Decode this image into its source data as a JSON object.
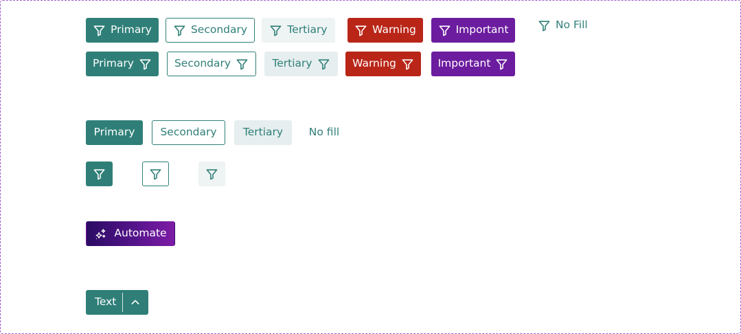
{
  "row1": {
    "primary": "Primary",
    "secondary": "Secondary",
    "tertiary": "Tertiary",
    "warning": "Warning",
    "important": "Important",
    "nofill": "No Fill"
  },
  "row2": {
    "primary": "Primary",
    "secondary": "Secondary",
    "tertiary": "Tertiary",
    "warning": "Warning",
    "important": "Important"
  },
  "row3": {
    "primary": "Primary",
    "secondary": "Secondary",
    "tertiary": "Tertiary",
    "nofill": "No fill"
  },
  "automate": {
    "label": "Automate"
  },
  "split": {
    "label": "Text"
  },
  "icons": {
    "filter": "filter-icon",
    "sparkle": "sparkle-icon",
    "chevron": "chevron-up-icon"
  },
  "colors": {
    "primary": "#2f7f78",
    "tertiary_bg": "#e6eeef",
    "warning": "#b92618",
    "important": "#6c1c9f",
    "automate_from": "#2a0b63",
    "automate_to": "#7d1ca6",
    "frame_border": "#9b59d0"
  }
}
